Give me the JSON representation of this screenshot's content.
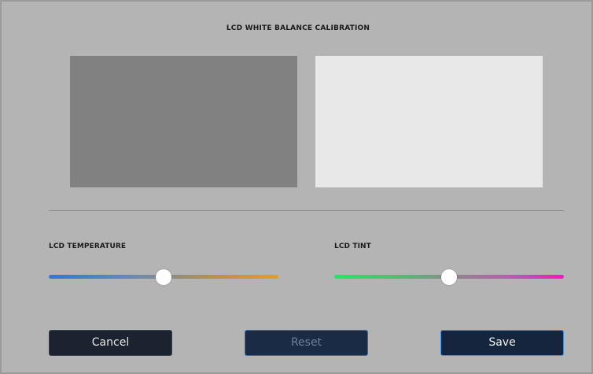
{
  "dialog": {
    "title": "LCD WHITE BALANCE CALIBRATION"
  },
  "swatches": {
    "dark_color": "#818181",
    "light_color": "#e8e8e8"
  },
  "sliders": {
    "temperature": {
      "label": "LCD TEMPERATURE",
      "value_fraction": 0.5,
      "gradient_start": "#2e76e6",
      "gradient_end": "#ef9a20"
    },
    "tint": {
      "label": "LCD TINT",
      "value_fraction": 0.5,
      "gradient_start": "#1fe86b",
      "gradient_end": "#f01cb8"
    }
  },
  "buttons": {
    "cancel_label": "Cancel",
    "reset_label": "Reset",
    "save_label": "Save"
  },
  "colors": {
    "background": "#b4b4b4",
    "button_dark": "#1c2230",
    "button_accent_border": "#3a8fe0"
  }
}
